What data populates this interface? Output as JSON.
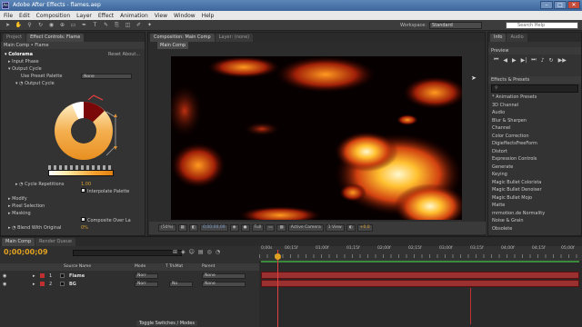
{
  "window": {
    "title": "Adobe After Effects - flames.aep",
    "controls": [
      "–",
      "□",
      "✕"
    ]
  },
  "menu": [
    "File",
    "Edit",
    "Composition",
    "Layer",
    "Effect",
    "Animation",
    "View",
    "Window",
    "Help"
  ],
  "toolbar": {
    "tools": [
      "selection-tool-icon",
      "hand-tool-icon",
      "zoom-tool-icon",
      "rotate-tool-icon",
      "camera-tool-icon",
      "pan-behind-tool-icon",
      "rectangle-tool-icon",
      "pen-tool-icon",
      "text-tool-icon",
      "brush-tool-icon",
      "clone-tool-icon",
      "eraser-tool-icon",
      "roto-brush-tool-icon",
      "puppet-tool-icon"
    ],
    "workspace_label": "Workspace:",
    "workspace_value": "Standard",
    "search_placeholder": "Search Help"
  },
  "left_panel": {
    "tabs": [
      "Project",
      "Effect Controls: Flame"
    ],
    "breadcrumb": "Main Comp • Flame",
    "rows": [
      {
        "label": "Colorama",
        "value": "Reset    About..."
      },
      {
        "label": "Input Phase"
      },
      {
        "label": "Output Cycle"
      },
      {
        "label": "Use Preset Palette",
        "dropdown": "None"
      },
      {
        "label": "Output Cycle"
      },
      {
        "label": "Cycle Repetitions",
        "value": "1.00"
      },
      {
        "label": "Interpolate Palette"
      },
      {
        "label": "Modify"
      },
      {
        "label": "Pixel Selection"
      },
      {
        "label": "Masking"
      },
      {
        "label": "Composite Over La"
      },
      {
        "label": "Blend With Original",
        "value": "0%"
      }
    ]
  },
  "composition_panel": {
    "tabs": [
      "Composition: Main Comp",
      "Layer: (none)"
    ],
    "subtab": "Main Comp",
    "zoom": "(50%)",
    "timecode": "0;00;00;09",
    "resolution": "Full",
    "camera": "Active Camera",
    "views": "1 View",
    "exposure": "+0.0"
  },
  "right_panel": {
    "preview_tabs": [
      "Info",
      "Audio"
    ],
    "preview_label": "Preview",
    "effects_tab": "Effects & Presets",
    "effects": [
      "* Animation Presets",
      "3D Channel",
      "Audio",
      "Blur & Sharpen",
      "Channel",
      "Color Correction",
      "DigieffectsFreeForm",
      "Distort",
      "Expression Controls",
      "Generate",
      "Keying",
      "Magic Bullet Colorista",
      "Magic Bullet Denoiser",
      "Magic Bullet Mojo",
      "Matte",
      "mrmotion.de Normality",
      "Noise & Grain",
      "Obsolete"
    ]
  },
  "timeline": {
    "tabs": [
      "Main Comp",
      "Render Queue"
    ],
    "timecode": "0;00;00;09",
    "columns": [
      "Source Name",
      "Mode",
      "T TrkMat",
      "Parent"
    ],
    "layers": [
      {
        "num": "1",
        "name": "Flame",
        "mode": "Norr",
        "trkmat": "",
        "parent": "None",
        "color": "#c03030"
      },
      {
        "num": "2",
        "name": "BG",
        "mode": "Norr",
        "trkmat": "No",
        "parent": "None",
        "color": "#c03030"
      }
    ],
    "ruler": [
      "0;00s",
      "00;15f",
      "01;00f",
      "01;15f",
      "02;00f",
      "02;15f",
      "03;00f",
      "03;15f",
      "04;00f",
      "04;15f",
      "05;00f"
    ],
    "footer": "Toggle Switches / Modes"
  }
}
